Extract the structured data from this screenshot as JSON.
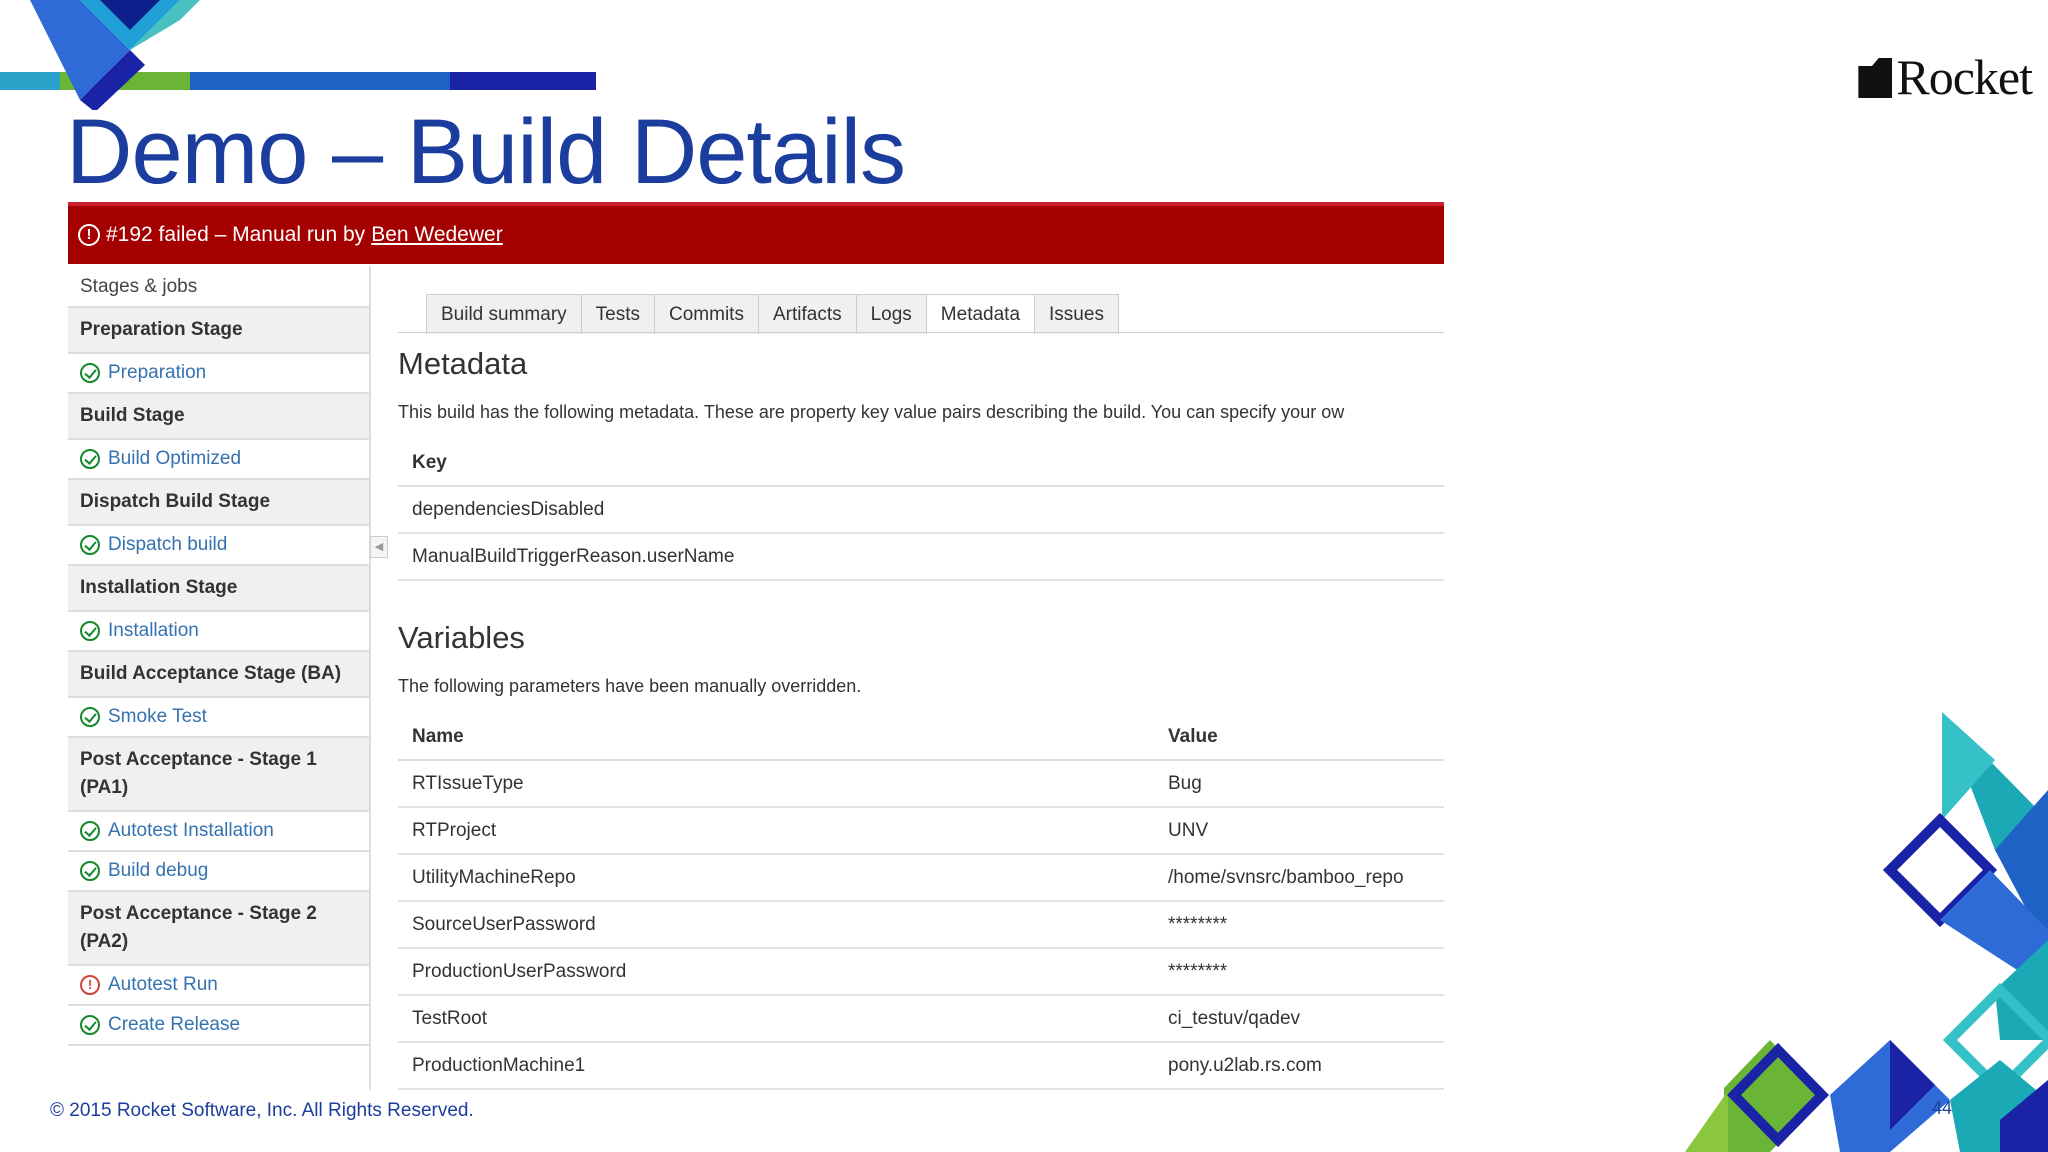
{
  "slide": {
    "title": "Demo – Build Details",
    "logo_text": "Rocket",
    "copyright": "© 2015 Rocket Software, Inc. All Rights Reserved.",
    "page_number": "44"
  },
  "colors": {
    "title_blue": "#1a3d9e",
    "fail_red": "#a50000",
    "link_blue": "#3572b0",
    "success_green": "#14892c",
    "error_red": "#d04437"
  },
  "build": {
    "status_icon": "warning-circle-icon",
    "status_text": "#192 failed – Manual run by",
    "user": "Ben Wedewer"
  },
  "sidebar": {
    "header": "Stages & jobs",
    "stages": [
      {
        "name": "Preparation Stage",
        "jobs": [
          {
            "name": "Preparation",
            "status": "success"
          }
        ]
      },
      {
        "name": "Build Stage",
        "jobs": [
          {
            "name": "Build Optimized",
            "status": "success"
          }
        ]
      },
      {
        "name": "Dispatch Build Stage",
        "jobs": [
          {
            "name": "Dispatch build",
            "status": "success"
          }
        ]
      },
      {
        "name": "Installation Stage",
        "jobs": [
          {
            "name": "Installation",
            "status": "success"
          }
        ]
      },
      {
        "name": "Build Acceptance Stage (BA)",
        "jobs": [
          {
            "name": "Smoke Test",
            "status": "success"
          }
        ]
      },
      {
        "name": "Post Acceptance - Stage 1 (PA1)",
        "jobs": [
          {
            "name": "Autotest Installation",
            "status": "success"
          },
          {
            "name": "Build debug",
            "status": "success"
          }
        ]
      },
      {
        "name": "Post Acceptance - Stage 2 (PA2)",
        "jobs": [
          {
            "name": "Autotest Run",
            "status": "failed"
          },
          {
            "name": "Create Release",
            "status": "success"
          }
        ]
      }
    ]
  },
  "tabs": [
    "Build summary",
    "Tests",
    "Commits",
    "Artifacts",
    "Logs",
    "Metadata",
    "Issues"
  ],
  "active_tab": "Metadata",
  "metadata": {
    "heading": "Metadata",
    "description": "This build has the following metadata. These are property key value pairs describing the build. You can specify your ow",
    "key_header": "Key",
    "keys": [
      "dependenciesDisabled",
      "ManualBuildTriggerReason.userName"
    ]
  },
  "variables": {
    "heading": "Variables",
    "description": "The following parameters have been manually overridden.",
    "name_header": "Name",
    "value_header": "Value",
    "rows": [
      {
        "name": "RTIssueType",
        "value": "Bug"
      },
      {
        "name": "RTProject",
        "value": "UNV"
      },
      {
        "name": "UtilityMachineRepo",
        "value": "/home/svnsrc/bamboo_repo"
      },
      {
        "name": "SourceUserPassword",
        "value": "********"
      },
      {
        "name": "ProductionUserPassword",
        "value": "********"
      },
      {
        "name": "TestRoot",
        "value": "ci_testuv/qadev"
      },
      {
        "name": "ProductionMachine1",
        "value": "pony.u2lab.rs.com"
      }
    ]
  }
}
